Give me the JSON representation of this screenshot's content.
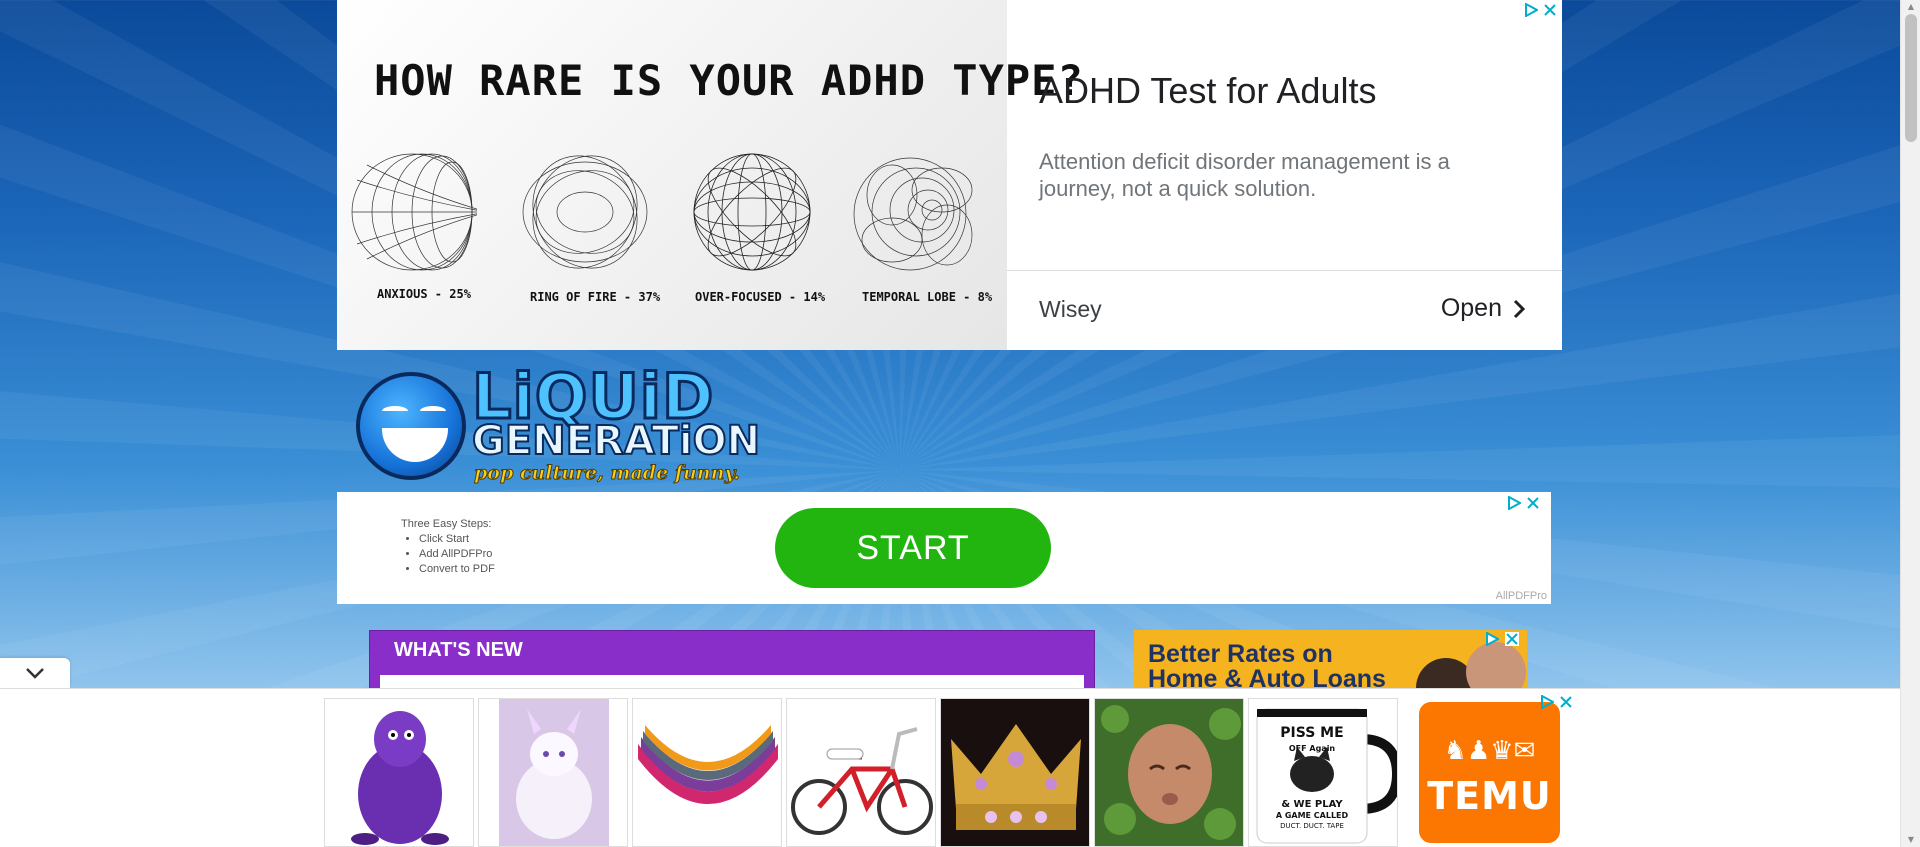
{
  "top_ad": {
    "image_headline": "HOW RARE IS YOUR ADHD TYPE?",
    "types": [
      {
        "label": "ANXIOUS - 25%"
      },
      {
        "label": "RING OF FIRE - 37%"
      },
      {
        "label": "OVER-FOCUSED - 14%"
      },
      {
        "label": "TEMPORAL LOBE - 8%"
      }
    ],
    "title": "ADHD Test for Adults",
    "description": "Attention deficit disorder management is a journey, not a quick solution.",
    "advertiser": "Wisey",
    "cta": "Open"
  },
  "logo": {
    "word1": "LiQUiD",
    "word2": "GENERATiON",
    "tagline": "pop culture, made funny."
  },
  "mid_ad": {
    "steps_heading": "Three Easy Steps:",
    "steps": [
      "Click Start",
      "Add AllPDFPro",
      "Convert to PDF"
    ],
    "button": "START",
    "brand": "AllPDFPro"
  },
  "whats_new": {
    "title": "WHAT'S NEW"
  },
  "right_ad": {
    "line1": "Better Rates on",
    "line2": "Home & Auto Loans"
  },
  "bottom_ad": {
    "temu_label": "TEMU",
    "mug_text": [
      "PISS ME",
      "OFF Again",
      "& WE PLAY",
      "A GAME CALLED",
      "DUCT. DUCT. TAPE"
    ]
  },
  "colors": {
    "accent_purple": "#8a2ec9",
    "start_green": "#22b510",
    "temu_orange": "#fb7701",
    "adchoices_blue": "#00aecd"
  }
}
